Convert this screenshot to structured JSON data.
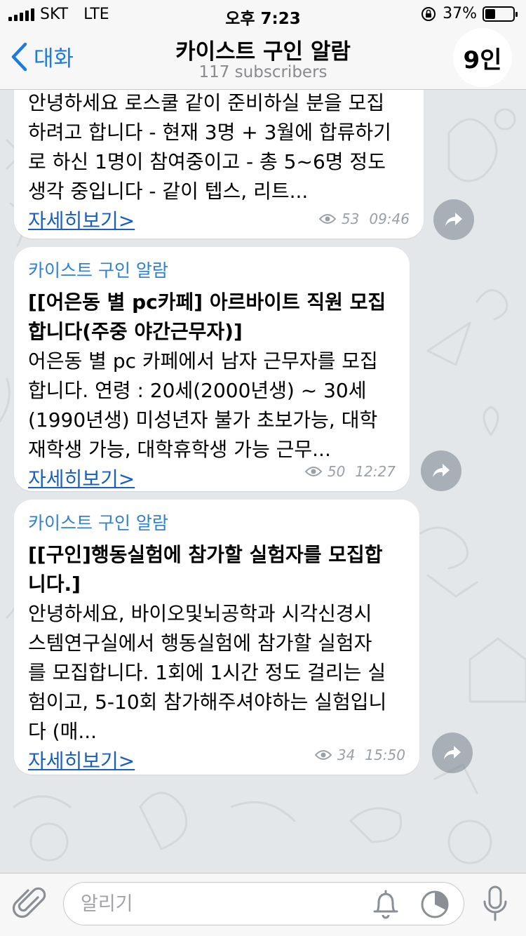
{
  "status_bar": {
    "carrier": "SKT",
    "network": "LTE",
    "time": "오후 7:23",
    "battery_percent": "37%",
    "battery_level": 0.37
  },
  "nav": {
    "back_label": "대화",
    "title": "카이스트 구인 알람",
    "subtitle": "117 subscribers",
    "avatar_text": "9인"
  },
  "messages": [
    {
      "text": "안녕하세요 로스쿨 같이 준비하실 분을 모집하려고 합니다 - 현재 3명 + 3월에 합류하기로 하신 1명이 참여중이고 - 총 5~6명 정도 생각 중입니다 - 같이 텝스, 리트...",
      "lines": [
        "안녕하세요 로스쿨 같이 준비하실 분을 모집",
        "하려고 합니다 - 현재 3명 + 3월에 합류하기",
        "로 하신 1명이 참여중이고 - 총 5~6명 정도",
        "생각 중입니다 - 같이 텝스, 리트..."
      ],
      "more": "자세히보기>",
      "views": "53",
      "time": "09:46"
    },
    {
      "channel": "카이스트 구인 알람",
      "title_lines": [
        "[[어은동 별 pc카페] 아르바이트 직원 모집",
        "합니다(주중 야간근무자)]"
      ],
      "lines": [
        "어은동 별 pc 카페에서 남자 근무자를 모집",
        "합니다. 연령 : 20세(2000년생) ~ 30세",
        "(1990년생) 미성년자 불가 초보가능, 대학",
        "재학생 가능, 대학휴학생 가능 근무..."
      ],
      "more": "자세히보기>",
      "views": "50",
      "time": "12:27"
    },
    {
      "channel": "카이스트 구인 알람",
      "title_lines": [
        "[[구인]행동실험에 참가할 실험자를 모집합",
        "니다.]"
      ],
      "lines": [
        "안녕하세요, 바이오및뇌공학과 시각신경시",
        "스템연구실에서 행동실험에 참가할 실험자",
        "를 모집합니다. 1회에 1시간 정도 걸리는 실",
        "험이고, 5-10회 참가해주셔야하는 실험입니",
        "다 (매..."
      ],
      "more": "자세히보기>",
      "views": "34",
      "time": "15:50"
    }
  ],
  "input": {
    "placeholder": "알리기"
  },
  "icons": {
    "back": "chevron-left-icon",
    "forward": "share-forward-icon",
    "views": "eye-icon",
    "attach": "paperclip-icon",
    "mute": "bell-icon",
    "timer": "timer-icon",
    "mic": "microphone-icon"
  },
  "colors": {
    "accent": "#1f7ae0",
    "link": "#1a5fbf",
    "channel": "#2f80d1",
    "background": "#e3e7ea"
  }
}
